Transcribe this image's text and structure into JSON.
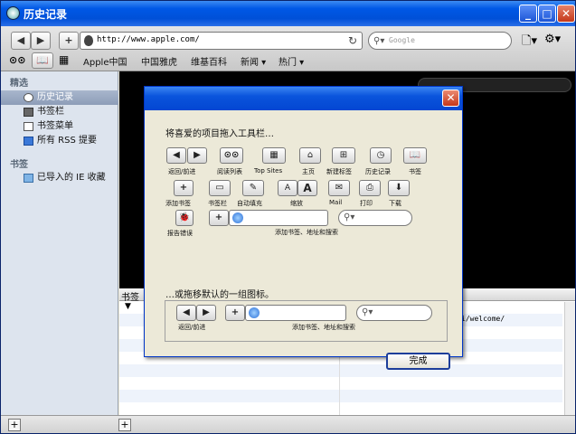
{
  "window": {
    "title": "历史记录"
  },
  "toolbar": {
    "url": "http://www.apple.com/",
    "search_placeholder": "Google"
  },
  "bookmarks_bar": {
    "items": [
      "Apple中国",
      "中国雅虎",
      "维基百科",
      "新闻 ▾",
      "热门 ▾"
    ]
  },
  "sidebar": {
    "section1": "精选",
    "items1": [
      "历史记录",
      "书签栏",
      "书签菜单",
      "所有 RSS 提要"
    ],
    "section2": "书签",
    "items2": [
      "已导入的 IE 收藏"
    ]
  },
  "content": {
    "column_header": "书签",
    "row_text": "i/welcome/"
  },
  "dialog": {
    "prompt": "将喜爱的项目拖入工具栏…",
    "items": [
      {
        "label": "返回/前进"
      },
      {
        "label": "阅读列表"
      },
      {
        "label": "Top Sites"
      },
      {
        "label": "主页"
      },
      {
        "label": "新建标签"
      },
      {
        "label": "历史记录"
      },
      {
        "label": "书签"
      },
      {
        "label": "添加书签"
      },
      {
        "label": "书签栏"
      },
      {
        "label": "自动填充"
      },
      {
        "label": "缩放"
      },
      {
        "label": "Mail"
      },
      {
        "label": "打印"
      },
      {
        "label": "下载"
      },
      {
        "label": "报告错误"
      },
      {
        "label": "添加书签、地址和搜索"
      }
    ],
    "default_prompt": "…或拖移默认的一组图标。",
    "default_back": "返回/前进",
    "default_addr": "添加书签、地址和搜索",
    "done": "完成"
  }
}
